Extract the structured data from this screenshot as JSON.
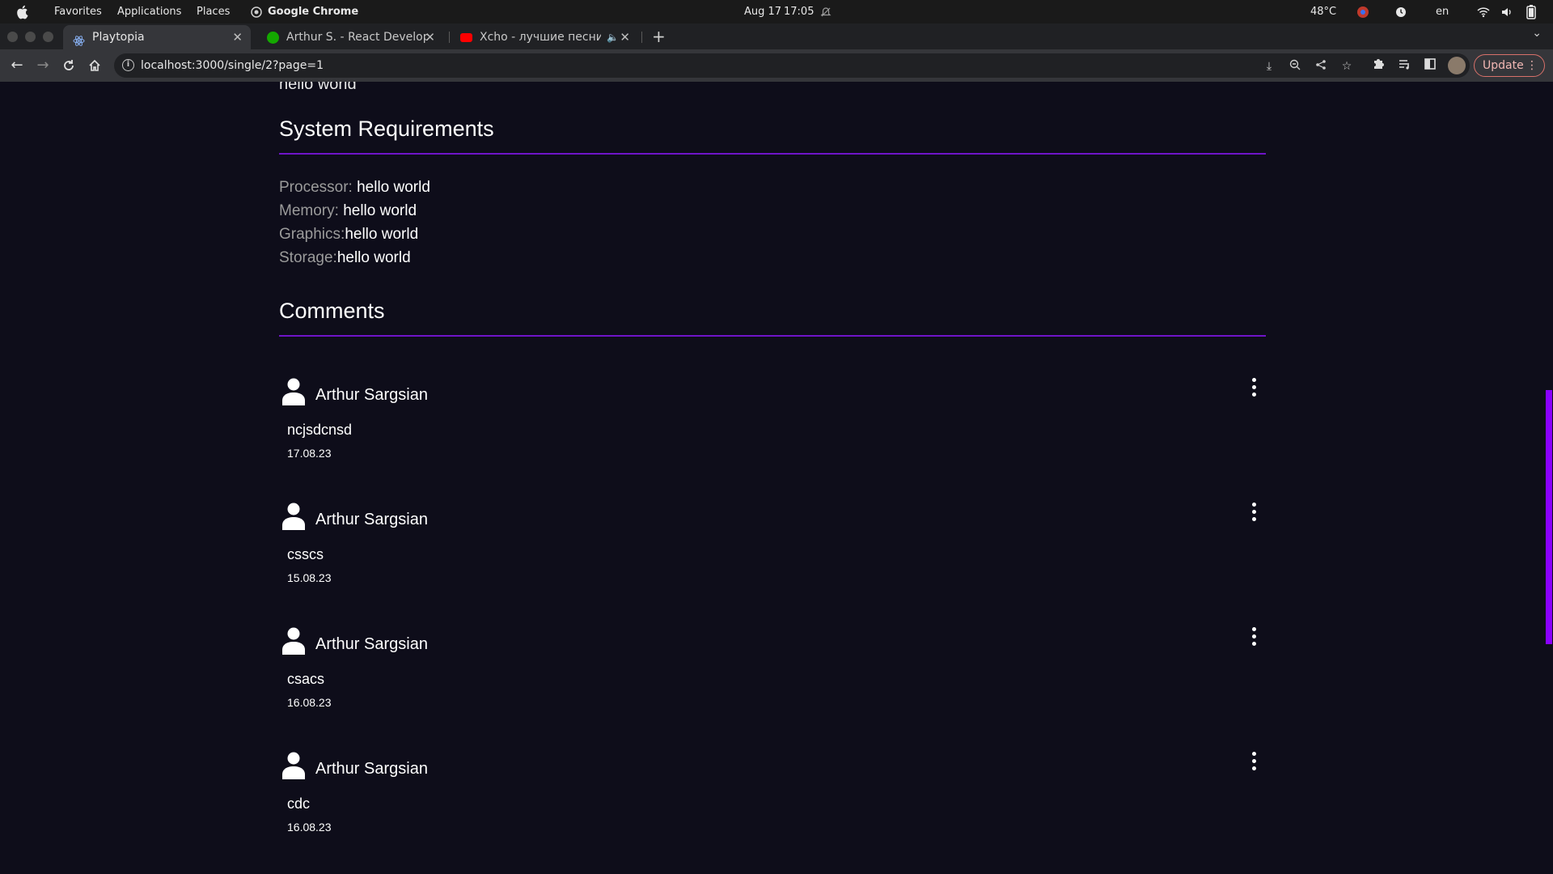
{
  "os_bar": {
    "menus": [
      "Favorites",
      "Applications",
      "Places"
    ],
    "active_app": "Google Chrome",
    "date": "Aug 17",
    "time": "17:05",
    "temperature": "48°C",
    "language": "en"
  },
  "tabs": [
    {
      "title": "Playtopia",
      "active": true,
      "favicon": "react-icon"
    },
    {
      "title": "Arthur S. - React Develope",
      "active": false,
      "favicon": "upwork-icon"
    },
    {
      "title": "Xcho - лучшие песни",
      "active": false,
      "favicon": "youtube-icon",
      "audio": true
    }
  ],
  "toolbar": {
    "url": "localhost:3000/single/2?page=1",
    "update_label": "Update"
  },
  "page": {
    "partial_text": "hello world",
    "system_requirements": {
      "title": "System Requirements",
      "items": [
        {
          "label": "Processor: ",
          "value": "hello world"
        },
        {
          "label": "Memory: ",
          "value": "hello world"
        },
        {
          "label": "Graphics:",
          "value": "hello world"
        },
        {
          "label": "Storage:",
          "value": "hello world"
        }
      ]
    },
    "comments": {
      "title": "Comments",
      "items": [
        {
          "author": "Arthur Sargsian",
          "text": "ncjsdcnsd",
          "date": "17.08.23"
        },
        {
          "author": "Arthur Sargsian",
          "text": "csscs",
          "date": "15.08.23"
        },
        {
          "author": "Arthur Sargsian",
          "text": "csacs",
          "date": "16.08.23"
        },
        {
          "author": "Arthur Sargsian",
          "text": "cdc",
          "date": "16.08.23"
        }
      ]
    }
  },
  "colors": {
    "page_background": "#0e0d1a",
    "accent": "#6f14c8",
    "scrollbar": "#8a00ff"
  }
}
